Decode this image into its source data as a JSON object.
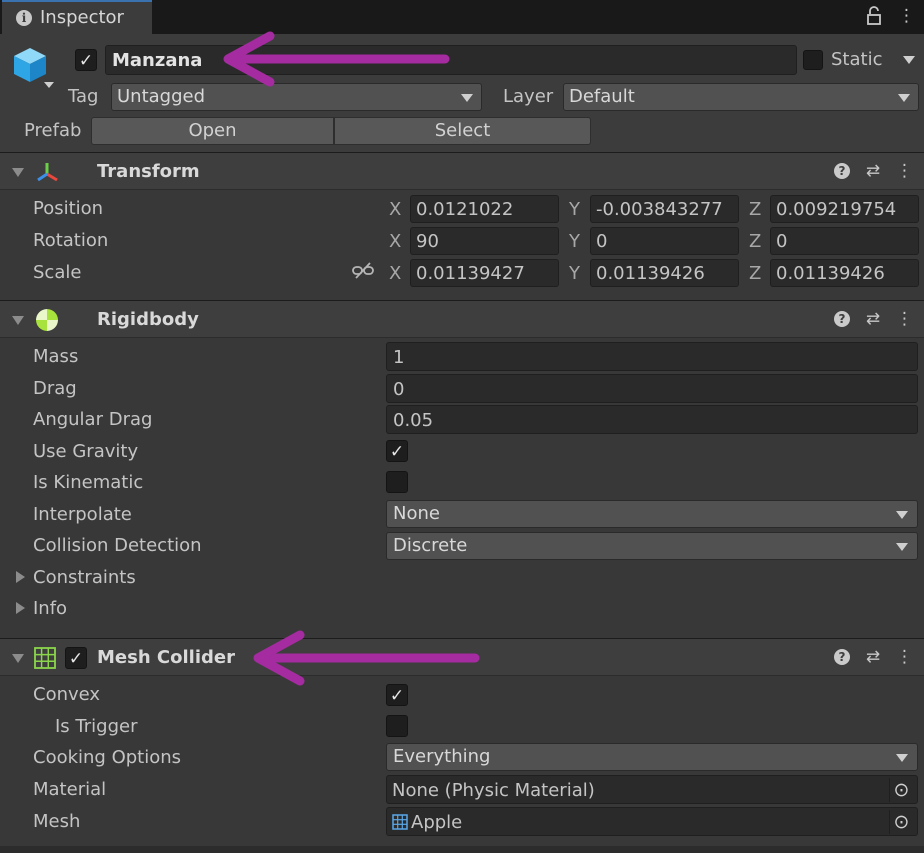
{
  "tab": {
    "title": "Inspector",
    "info_icon": "info-icon",
    "lock_icon": "lock-icon"
  },
  "object": {
    "name": "Manzana",
    "active": true,
    "static_label": "Static",
    "tag_label": "Tag",
    "tag_value": "Untagged",
    "layer_label": "Layer",
    "layer_value": "Default",
    "prefab_label": "Prefab",
    "open_label": "Open",
    "select_label": "Select"
  },
  "transform": {
    "title": "Transform",
    "position_label": "Position",
    "rotation_label": "Rotation",
    "scale_label": "Scale",
    "axis_x": "X",
    "axis_y": "Y",
    "axis_z": "Z",
    "position": {
      "x": "0.0121022",
      "y": "-0.003843277",
      "z": "0.009219754"
    },
    "rotation": {
      "x": "90",
      "y": "0",
      "z": "0"
    },
    "scale": {
      "x": "0.01139427",
      "y": "0.01139426",
      "z": "0.01139426"
    }
  },
  "rigidbody": {
    "title": "Rigidbody",
    "mass_label": "Mass",
    "mass": "1",
    "drag_label": "Drag",
    "drag": "0",
    "angular_drag_label": "Angular Drag",
    "angular_drag": "0.05",
    "use_gravity_label": "Use Gravity",
    "use_gravity": true,
    "is_kinematic_label": "Is Kinematic",
    "is_kinematic": false,
    "interpolate_label": "Interpolate",
    "interpolate": "None",
    "collision_label": "Collision Detection",
    "collision": "Discrete",
    "constraints_label": "Constraints",
    "info_label": "Info"
  },
  "mesh_collider": {
    "title": "Mesh Collider",
    "enabled": true,
    "convex_label": "Convex",
    "convex": true,
    "is_trigger_label": "Is Trigger",
    "is_trigger": false,
    "cooking_label": "Cooking Options",
    "cooking": "Everything",
    "material_label": "Material",
    "material": "None (Physic Material)",
    "mesh_label": "Mesh",
    "mesh": "Apple"
  },
  "annotation_color": "#a42ba0",
  "glyphs": {
    "check": "✓",
    "help": "?",
    "more": "⋮",
    "presets": "⇄",
    "target": "⊙"
  }
}
